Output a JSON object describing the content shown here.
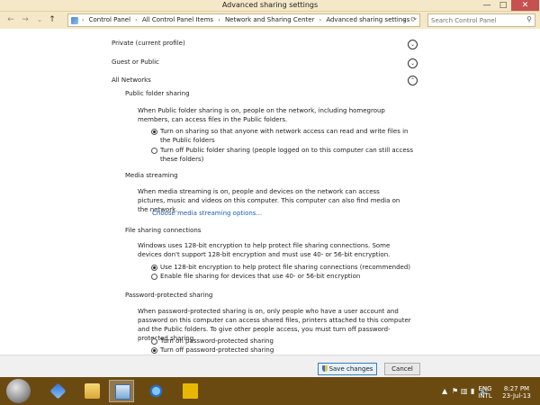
{
  "window": {
    "title": "Advanced sharing settings",
    "minimize_glyph": "—",
    "maximize_glyph": "□",
    "close_glyph": "✕"
  },
  "nav": {
    "back_glyph": "←",
    "forward_glyph": "→",
    "up_glyph": "↑",
    "history_glyph": "⌄"
  },
  "address": {
    "crumbs": [
      "Control Panel",
      "All Control Panel Items",
      "Network and Sharing Center",
      "Advanced sharing settings"
    ],
    "separator": "›",
    "dropdown_glyph": "⌄",
    "refresh_glyph": "⟳"
  },
  "search": {
    "placeholder": "Search Control Panel",
    "icon_glyph": "⚲"
  },
  "profiles": {
    "private": "Private (current profile)",
    "guest": "Guest or Public",
    "all": "All Networks",
    "expand_glyph": "⌄",
    "collapse_glyph": "⌃"
  },
  "public_folder": {
    "heading": "Public folder sharing",
    "description": "When Public folder sharing is on, people on the network, including homegroup members, can access files in the Public folders.",
    "option_on": "Turn on sharing so that anyone with network access can read and write files in the Public folders",
    "option_off": "Turn off Public folder sharing (people logged on to this computer can still access these folders)",
    "selected": "on"
  },
  "media": {
    "heading": "Media streaming",
    "description": "When media streaming is on, people and devices on the network can access pictures, music and videos on this computer. This computer can also find media on the network.",
    "link": "Choose media streaming options..."
  },
  "file_sharing": {
    "heading": "File sharing connections",
    "description": "Windows uses 128-bit encryption to help protect file sharing connections. Some devices don't support 128-bit encryption and must use 40- or 56-bit encryption.",
    "option_128": "Use 128-bit encryption to help protect file sharing connections (recommended)",
    "option_40": "Enable file sharing for devices that use 40- or 56-bit encryption",
    "selected": "128"
  },
  "password": {
    "heading": "Password-protected sharing",
    "description": "When password-protected sharing is on, only people who have a user account and password on this computer can access shared files, printers attached to this computer and the Public folders. To give other people access, you must turn off password-protected sharing.",
    "option_on": "Turn on password-protected sharing",
    "option_off": "Turn off password-protected sharing",
    "selected": "off"
  },
  "buttons": {
    "save": "Save changes",
    "cancel": "Cancel"
  },
  "taskbar": {
    "lang_top": "ENG",
    "lang_bottom": "INTL",
    "time": "8:27 PM",
    "date": "23-Jul-13",
    "tray_glyphs": [
      "▲",
      "⚑",
      "▥",
      "▮",
      "🔊"
    ],
    "apps": [
      "start-orb",
      "network-explorer",
      "file-explorer",
      "control-panel",
      "internet-explorer",
      "utility-app"
    ]
  },
  "colors": {
    "frame": "#f5e8c8",
    "taskbar": "#6b4a12",
    "link": "#1a5cb5",
    "close_button": "#c75050"
  }
}
